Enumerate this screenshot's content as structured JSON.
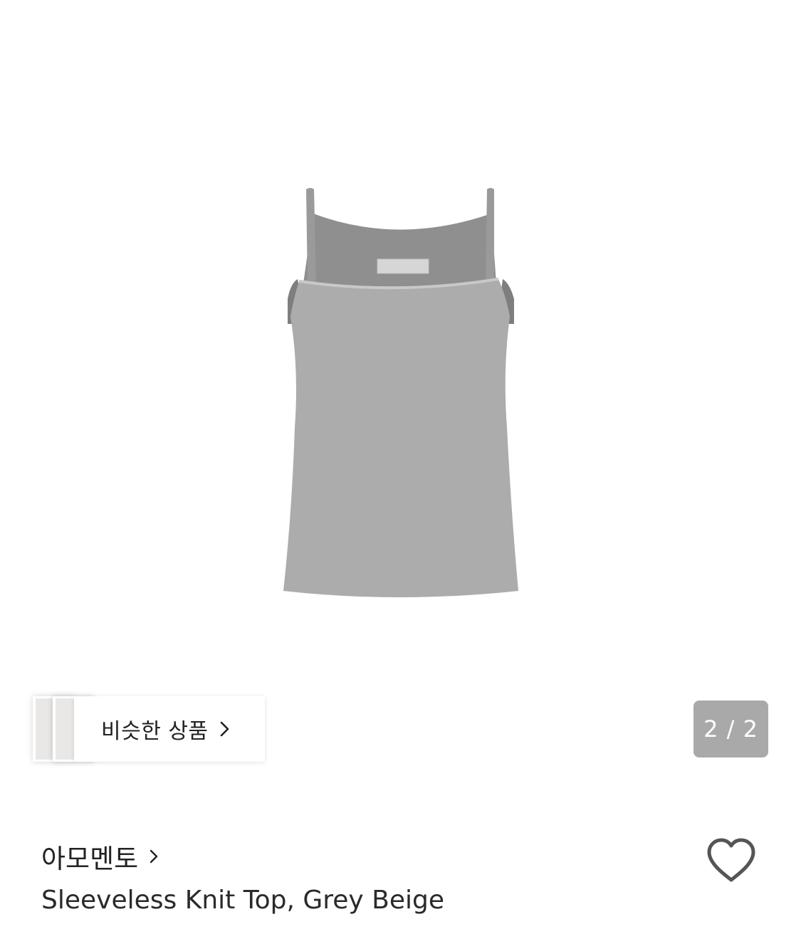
{
  "product": {
    "image_alt": "Grey sleeveless knit camisole top",
    "brand": "아모멘토",
    "title": "Sleeveless Knit Top, Grey Beige"
  },
  "similar": {
    "label": "비슷한 상품"
  },
  "pager": {
    "text": "2 / 2"
  },
  "colors": {
    "garment": "#acacac",
    "garment_shadow": "#8f8f8f",
    "counter_bg": "#a9a9a9",
    "text": "#222222",
    "heart_stroke": "#555555"
  },
  "icons": {
    "similar_chevron": "chevron-right-icon",
    "brand_chevron": "chevron-right-icon",
    "wishlist": "heart-outline-icon"
  }
}
